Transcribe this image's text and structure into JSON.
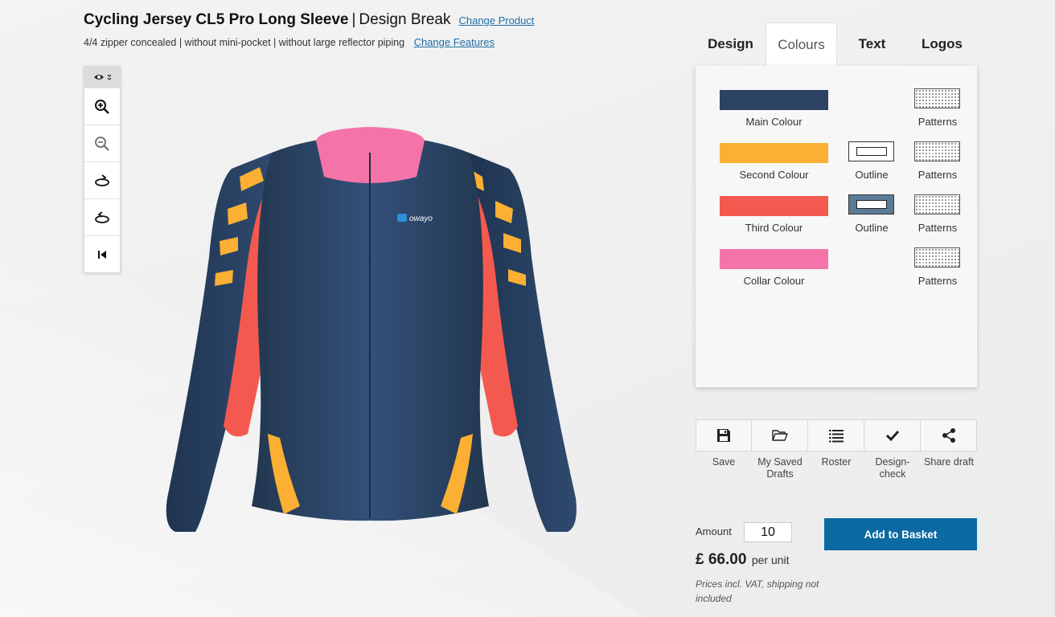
{
  "header": {
    "product_name": "Cycling Jersey CL5 Pro Long Sleeve",
    "separator": "|",
    "design_name": "Design Break",
    "change_product": "Change Product",
    "features": "4/4 zipper concealed | without mini-pocket | without large reflector piping",
    "change_features": "Change Features"
  },
  "toolbar": {
    "items": [
      {
        "icon": "eye-icon"
      },
      {
        "icon": "zoom-in-icon"
      },
      {
        "icon": "zoom-out-icon"
      },
      {
        "icon": "rotate-right-icon"
      },
      {
        "icon": "rotate-left-icon"
      },
      {
        "icon": "reset-view-icon"
      }
    ]
  },
  "jersey": {
    "brand_text": "owayo",
    "colors": {
      "main": "#2c4363",
      "second": "#fbb034",
      "third": "#f4594f",
      "collar": "#f474aa"
    }
  },
  "tabs": [
    {
      "label": "Design",
      "active": false
    },
    {
      "label": "Colours",
      "active": true
    },
    {
      "label": "Text",
      "active": false
    },
    {
      "label": "Logos",
      "active": false
    }
  ],
  "colours_panel": {
    "rows": [
      {
        "label": "Main Colour",
        "color": "#2c4363",
        "outline": null,
        "pattern_label": "Patterns"
      },
      {
        "label": "Second Colour",
        "color": "#fbb034",
        "outline": {
          "label": "Outline",
          "color": "#ffffff"
        },
        "pattern_label": "Patterns"
      },
      {
        "label": "Third Colour",
        "color": "#f4594f",
        "outline": {
          "label": "Outline",
          "color": "#5b7b96"
        },
        "pattern_label": "Patterns"
      },
      {
        "label": "Collar Colour",
        "color": "#f474aa",
        "outline": null,
        "pattern_label": "Patterns"
      }
    ]
  },
  "actions": [
    {
      "label": "Save",
      "icon": "floppy-disk-icon"
    },
    {
      "label": "My Saved Drafts",
      "icon": "folder-open-icon"
    },
    {
      "label": "Roster",
      "icon": "list-icon"
    },
    {
      "label": "Design-check",
      "icon": "checkmark-icon"
    },
    {
      "label": "Share draft",
      "icon": "share-icon"
    }
  ],
  "order": {
    "amount_label": "Amount",
    "amount_value": "10",
    "add_to_basket": "Add to Basket",
    "price": "£ 66.00",
    "per_unit": "per unit",
    "vat_note": "Prices incl. VAT, shipping not included"
  },
  "accent_color": "#0b6aa2"
}
